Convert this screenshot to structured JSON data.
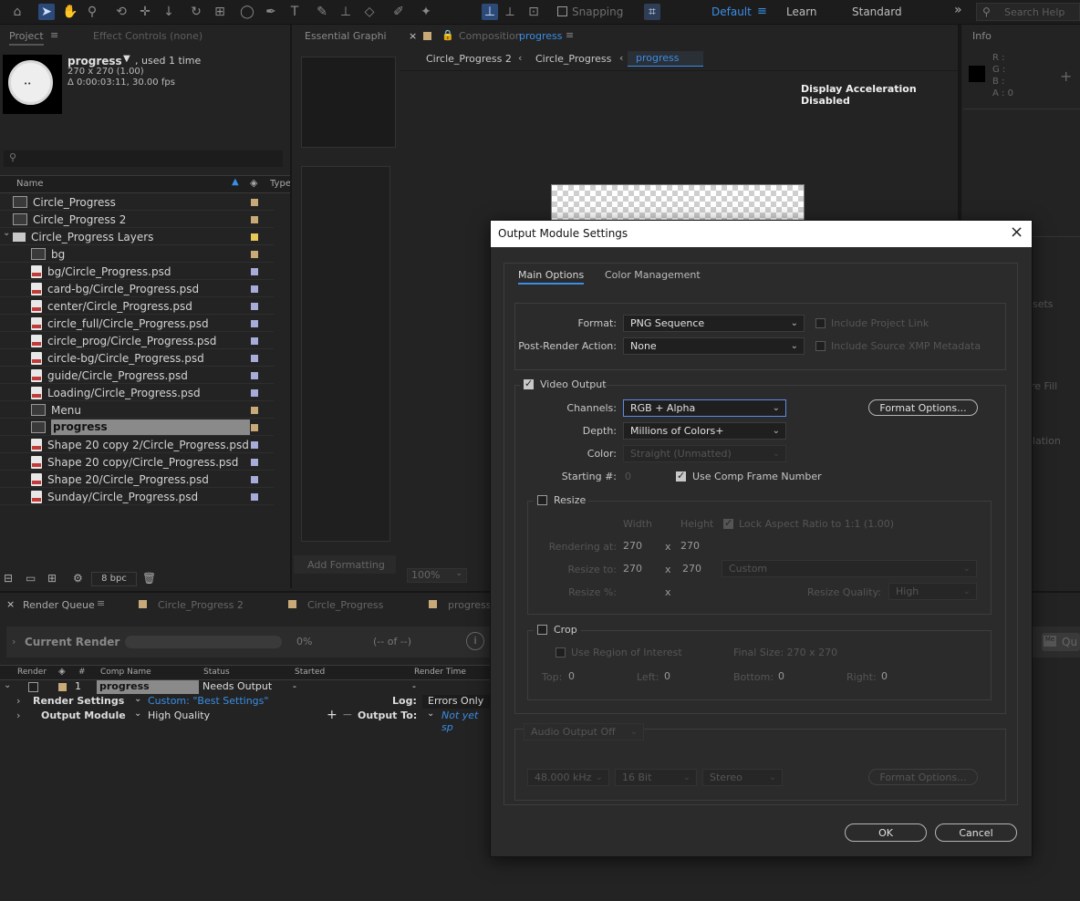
{
  "toolbar": {
    "snapping": "Snapping",
    "workspaces": [
      "Default",
      "Learn",
      "Standard"
    ],
    "search_placeholder": "Search Help"
  },
  "project": {
    "tab": "Project",
    "effect_tab": "Effect Controls (none)",
    "item_name": "progress",
    "used": ", used 1 time",
    "dims": "270 x 270 (1.00)",
    "duration": "Δ 0:00:03:11, 30.00 fps",
    "col_name": "Name",
    "col_type": "Type",
    "items": [
      {
        "name": "Circle_Progress",
        "kind": "comp",
        "indent": 0,
        "color": "#c7aa77"
      },
      {
        "name": "Circle_Progress 2",
        "kind": "comp",
        "indent": 0,
        "color": "#c7aa77"
      },
      {
        "name": "Circle_Progress Layers",
        "kind": "folder",
        "indent": 0,
        "color": "#e7c85a"
      },
      {
        "name": "bg",
        "kind": "comp",
        "indent": 1,
        "color": "#c7aa77"
      },
      {
        "name": "bg/Circle_Progress.psd",
        "kind": "psd",
        "indent": 1,
        "color": "#a8acd8"
      },
      {
        "name": "card-bg/Circle_Progress.psd",
        "kind": "psd",
        "indent": 1,
        "color": "#a8acd8"
      },
      {
        "name": "center/Circle_Progress.psd",
        "kind": "psd",
        "indent": 1,
        "color": "#a8acd8"
      },
      {
        "name": "circle_full/Circle_Progress.psd",
        "kind": "psd",
        "indent": 1,
        "color": "#a8acd8"
      },
      {
        "name": "circle_prog/Circle_Progress.psd",
        "kind": "psd",
        "indent": 1,
        "color": "#a8acd8"
      },
      {
        "name": "circle-bg/Circle_Progress.psd",
        "kind": "psd",
        "indent": 1,
        "color": "#a8acd8"
      },
      {
        "name": "guide/Circle_Progress.psd",
        "kind": "psd",
        "indent": 1,
        "color": "#a8acd8"
      },
      {
        "name": "Loading/Circle_Progress.psd",
        "kind": "psd",
        "indent": 1,
        "color": "#a8acd8"
      },
      {
        "name": "Menu",
        "kind": "comp",
        "indent": 1,
        "color": "#c7aa77"
      },
      {
        "name": "progress",
        "kind": "comp",
        "indent": 1,
        "color": "#c7aa77",
        "selected": true
      },
      {
        "name": "Shape 20 copy 2/Circle_Progress.psd",
        "kind": "psd",
        "indent": 1,
        "color": "#a8acd8"
      },
      {
        "name": "Shape 20 copy/Circle_Progress.psd",
        "kind": "psd",
        "indent": 1,
        "color": "#a8acd8"
      },
      {
        "name": "Shape 20/Circle_Progress.psd",
        "kind": "psd",
        "indent": 1,
        "color": "#a8acd8"
      },
      {
        "name": "Sunday/Circle_Progress.psd",
        "kind": "psd",
        "indent": 1,
        "color": "#a8acd8"
      }
    ],
    "bpc": "8 bpc"
  },
  "essential": {
    "tab": "Essential Graphi",
    "add_formatting": "Add Formatting"
  },
  "composition": {
    "tab_prefix": "Composition",
    "tab_name": "progress",
    "crumbs": [
      "Circle_Progress 2",
      "Circle_Progress",
      "progress"
    ],
    "accel": "Display Acceleration Disabled",
    "zoom": "100%"
  },
  "info": {
    "tab": "Info",
    "channels": [
      "R :",
      "G :",
      "B :",
      "A : 0"
    ],
    "side_labels": [
      "sets",
      "re Fill",
      "lation"
    ]
  },
  "render_queue": {
    "tabs": [
      "Render Queue",
      "Circle_Progress 2",
      "Circle_Progress",
      "progress"
    ],
    "current_render": "Current Render",
    "percent": "0%",
    "of": "(-- of --)",
    "headers": [
      "Render",
      "#",
      "Comp Name",
      "Status",
      "Started",
      "Render Time"
    ],
    "item": {
      "num": "1",
      "comp": "progress",
      "status": "Needs Output",
      "started": "-",
      "time": "-"
    },
    "render_settings_label": "Render Settings",
    "render_settings_value": "Custom: \"Best Settings\"",
    "log_label": "Log:",
    "log_value": "Errors Only",
    "output_module_label": "Output Module",
    "output_module_value": "High Quality",
    "output_to_label": "Output To:",
    "output_to_value": "Not yet sp",
    "queue_btn": "Qu"
  },
  "dialog": {
    "title": "Output Module Settings",
    "tabs": [
      "Main Options",
      "Color Management"
    ],
    "format_label": "Format:",
    "format_value": "PNG Sequence",
    "post_label": "Post-Render Action:",
    "post_value": "None",
    "include_project_link": "Include Project Link",
    "include_xmp": "Include Source XMP Metadata",
    "video_output": "Video Output",
    "channels_label": "Channels:",
    "channels_value": "RGB + Alpha",
    "format_options": "Format Options...",
    "depth_label": "Depth:",
    "depth_value": "Millions of Colors+",
    "color_label": "Color:",
    "color_value": "Straight (Unmatted)",
    "starting_label": "Starting #:",
    "starting_value": "0",
    "use_comp_frame": "Use Comp Frame Number",
    "resize": "Resize",
    "width": "Width",
    "height": "Height",
    "lock_aspect": "Lock Aspect Ratio to 1:1 (1.00)",
    "rendering_at": "Rendering at:",
    "render_w": "270",
    "render_h": "270",
    "x": "x",
    "resize_to": "Resize to:",
    "resize_w": "270",
    "resize_h": "270",
    "resize_preset": "Custom",
    "resize_pct": "Resize %:",
    "resize_quality_label": "Resize Quality:",
    "resize_quality": "High",
    "crop": "Crop",
    "use_roi": "Use Region of Interest",
    "final_size": "Final Size: 270 x 270",
    "top_label": "Top:",
    "top": "0",
    "left_label": "Left:",
    "left": "0",
    "bottom_label": "Bottom:",
    "bottom": "0",
    "right_label": "Right:",
    "right": "0",
    "audio_output": "Audio Output Off",
    "audio_rate": "48.000 kHz",
    "audio_bits": "16 Bit",
    "audio_channels": "Stereo",
    "audio_format_options": "Format Options...",
    "ok": "OK",
    "cancel": "Cancel"
  }
}
